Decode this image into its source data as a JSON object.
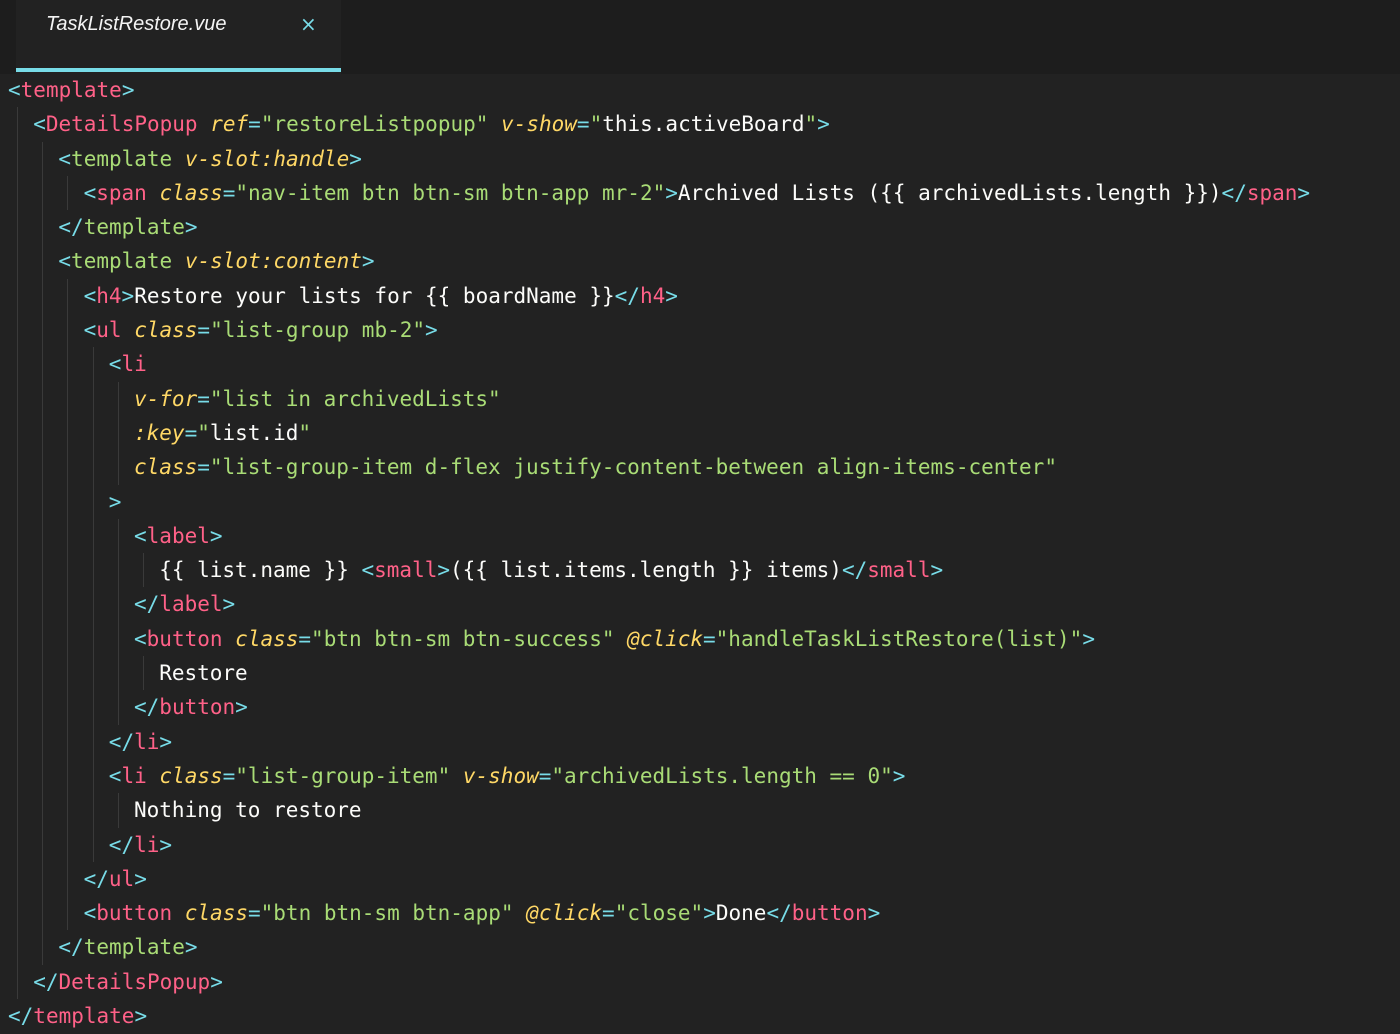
{
  "tab": {
    "title": "TaskListRestore.vue",
    "close_icon": "×"
  },
  "colors": {
    "background": "#222222",
    "punctuation": "#78dce8",
    "tag": "#ff6188",
    "attribute": "#ffd866",
    "string": "#a9dc76",
    "text": "#fcfcfa"
  },
  "code": {
    "lines": [
      {
        "indent": 0,
        "tokens": [
          [
            "p",
            "<"
          ],
          [
            "t",
            "template"
          ],
          [
            "p",
            ">"
          ]
        ]
      },
      {
        "indent": 1,
        "tokens": [
          [
            "p",
            "<"
          ],
          [
            "t",
            "DetailsPopup"
          ],
          [
            "x",
            " "
          ],
          [
            "a",
            "ref"
          ],
          [
            "p",
            "="
          ],
          [
            "s",
            "\"restoreListpopup\""
          ],
          [
            "x",
            " "
          ],
          [
            "a",
            "v-show"
          ],
          [
            "p",
            "="
          ],
          [
            "s",
            "\""
          ],
          [
            "x",
            "this.activeBoard"
          ],
          [
            "s",
            "\""
          ],
          [
            "p",
            ">"
          ]
        ]
      },
      {
        "indent": 2,
        "tokens": [
          [
            "p",
            "<"
          ],
          [
            "s",
            "template"
          ],
          [
            "x",
            " "
          ],
          [
            "a",
            "v-slot:handle"
          ],
          [
            "p",
            ">"
          ]
        ]
      },
      {
        "indent": 3,
        "tokens": [
          [
            "p",
            "<"
          ],
          [
            "t",
            "span"
          ],
          [
            "x",
            " "
          ],
          [
            "a",
            "class"
          ],
          [
            "p",
            "="
          ],
          [
            "s",
            "\"nav-item btn btn-sm btn-app mr-2\""
          ],
          [
            "p",
            ">"
          ],
          [
            "x",
            "Archived Lists ({{ archivedLists.length }})"
          ],
          [
            "p",
            "</"
          ],
          [
            "t",
            "span"
          ],
          [
            "p",
            ">"
          ]
        ]
      },
      {
        "indent": 2,
        "tokens": [
          [
            "p",
            "</"
          ],
          [
            "s",
            "template"
          ],
          [
            "p",
            ">"
          ]
        ]
      },
      {
        "indent": 2,
        "tokens": [
          [
            "p",
            "<"
          ],
          [
            "s",
            "template"
          ],
          [
            "x",
            " "
          ],
          [
            "a",
            "v-slot:content"
          ],
          [
            "p",
            ">"
          ]
        ]
      },
      {
        "indent": 3,
        "tokens": [
          [
            "p",
            "<"
          ],
          [
            "t",
            "h4"
          ],
          [
            "p",
            ">"
          ],
          [
            "x",
            "Restore your lists for {{ boardName }}"
          ],
          [
            "p",
            "</"
          ],
          [
            "t",
            "h4"
          ],
          [
            "p",
            ">"
          ]
        ]
      },
      {
        "indent": 3,
        "tokens": [
          [
            "p",
            "<"
          ],
          [
            "t",
            "ul"
          ],
          [
            "x",
            " "
          ],
          [
            "a",
            "class"
          ],
          [
            "p",
            "="
          ],
          [
            "s",
            "\"list-group mb-2\""
          ],
          [
            "p",
            ">"
          ]
        ]
      },
      {
        "indent": 4,
        "tokens": [
          [
            "p",
            "<"
          ],
          [
            "t",
            "li"
          ]
        ]
      },
      {
        "indent": 5,
        "tokens": [
          [
            "a",
            "v-for"
          ],
          [
            "p",
            "="
          ],
          [
            "s",
            "\"list in archivedLists\""
          ]
        ]
      },
      {
        "indent": 5,
        "tokens": [
          [
            "a",
            ":key"
          ],
          [
            "p",
            "="
          ],
          [
            "s",
            "\""
          ],
          [
            "x",
            "list.id"
          ],
          [
            "s",
            "\""
          ]
        ]
      },
      {
        "indent": 5,
        "tokens": [
          [
            "a",
            "class"
          ],
          [
            "p",
            "="
          ],
          [
            "s",
            "\"list-group-item d-flex justify-content-between align-items-center\""
          ]
        ]
      },
      {
        "indent": 4,
        "tokens": [
          [
            "p",
            ">"
          ]
        ]
      },
      {
        "indent": 5,
        "tokens": [
          [
            "p",
            "<"
          ],
          [
            "t",
            "label"
          ],
          [
            "p",
            ">"
          ]
        ]
      },
      {
        "indent": 6,
        "tokens": [
          [
            "x",
            "{{ list.name }} "
          ],
          [
            "p",
            "<"
          ],
          [
            "t",
            "small"
          ],
          [
            "p",
            ">"
          ],
          [
            "x",
            "({{ list.items.length }} items)"
          ],
          [
            "p",
            "</"
          ],
          [
            "t",
            "small"
          ],
          [
            "p",
            ">"
          ]
        ]
      },
      {
        "indent": 5,
        "tokens": [
          [
            "p",
            "</"
          ],
          [
            "t",
            "label"
          ],
          [
            "p",
            ">"
          ]
        ]
      },
      {
        "indent": 5,
        "tokens": [
          [
            "p",
            "<"
          ],
          [
            "t",
            "button"
          ],
          [
            "x",
            " "
          ],
          [
            "a",
            "class"
          ],
          [
            "p",
            "="
          ],
          [
            "s",
            "\"btn btn-sm btn-success\""
          ],
          [
            "x",
            " "
          ],
          [
            "a",
            "@click"
          ],
          [
            "p",
            "="
          ],
          [
            "s",
            "\"handleTaskListRestore(list)\""
          ],
          [
            "p",
            ">"
          ]
        ]
      },
      {
        "indent": 6,
        "tokens": [
          [
            "x",
            "Restore"
          ]
        ]
      },
      {
        "indent": 5,
        "tokens": [
          [
            "p",
            "</"
          ],
          [
            "t",
            "button"
          ],
          [
            "p",
            ">"
          ]
        ]
      },
      {
        "indent": 4,
        "tokens": [
          [
            "p",
            "</"
          ],
          [
            "t",
            "li"
          ],
          [
            "p",
            ">"
          ]
        ]
      },
      {
        "indent": 4,
        "tokens": [
          [
            "p",
            "<"
          ],
          [
            "t",
            "li"
          ],
          [
            "x",
            " "
          ],
          [
            "a",
            "class"
          ],
          [
            "p",
            "="
          ],
          [
            "s",
            "\"list-group-item\""
          ],
          [
            "x",
            " "
          ],
          [
            "a",
            "v-show"
          ],
          [
            "p",
            "="
          ],
          [
            "s",
            "\"archivedLists.length == 0\""
          ],
          [
            "p",
            ">"
          ]
        ]
      },
      {
        "indent": 5,
        "tokens": [
          [
            "x",
            "Nothing to restore"
          ]
        ]
      },
      {
        "indent": 4,
        "tokens": [
          [
            "p",
            "</"
          ],
          [
            "t",
            "li"
          ],
          [
            "p",
            ">"
          ]
        ]
      },
      {
        "indent": 3,
        "tokens": [
          [
            "p",
            "</"
          ],
          [
            "t",
            "ul"
          ],
          [
            "p",
            ">"
          ]
        ]
      },
      {
        "indent": 3,
        "tokens": [
          [
            "p",
            "<"
          ],
          [
            "t",
            "button"
          ],
          [
            "x",
            " "
          ],
          [
            "a",
            "class"
          ],
          [
            "p",
            "="
          ],
          [
            "s",
            "\"btn btn-sm btn-app\""
          ],
          [
            "x",
            " "
          ],
          [
            "a",
            "@click"
          ],
          [
            "p",
            "="
          ],
          [
            "s",
            "\"close\""
          ],
          [
            "p",
            ">"
          ],
          [
            "x",
            "Done"
          ],
          [
            "p",
            "</"
          ],
          [
            "t",
            "button"
          ],
          [
            "p",
            ">"
          ]
        ]
      },
      {
        "indent": 2,
        "tokens": [
          [
            "p",
            "</"
          ],
          [
            "s",
            "template"
          ],
          [
            "p",
            ">"
          ]
        ]
      },
      {
        "indent": 1,
        "tokens": [
          [
            "p",
            "</"
          ],
          [
            "t",
            "DetailsPopup"
          ],
          [
            "p",
            ">"
          ]
        ]
      },
      {
        "indent": 0,
        "tokens": [
          [
            "p",
            "</"
          ],
          [
            "t",
            "template"
          ],
          [
            "p",
            ">"
          ]
        ]
      }
    ]
  }
}
